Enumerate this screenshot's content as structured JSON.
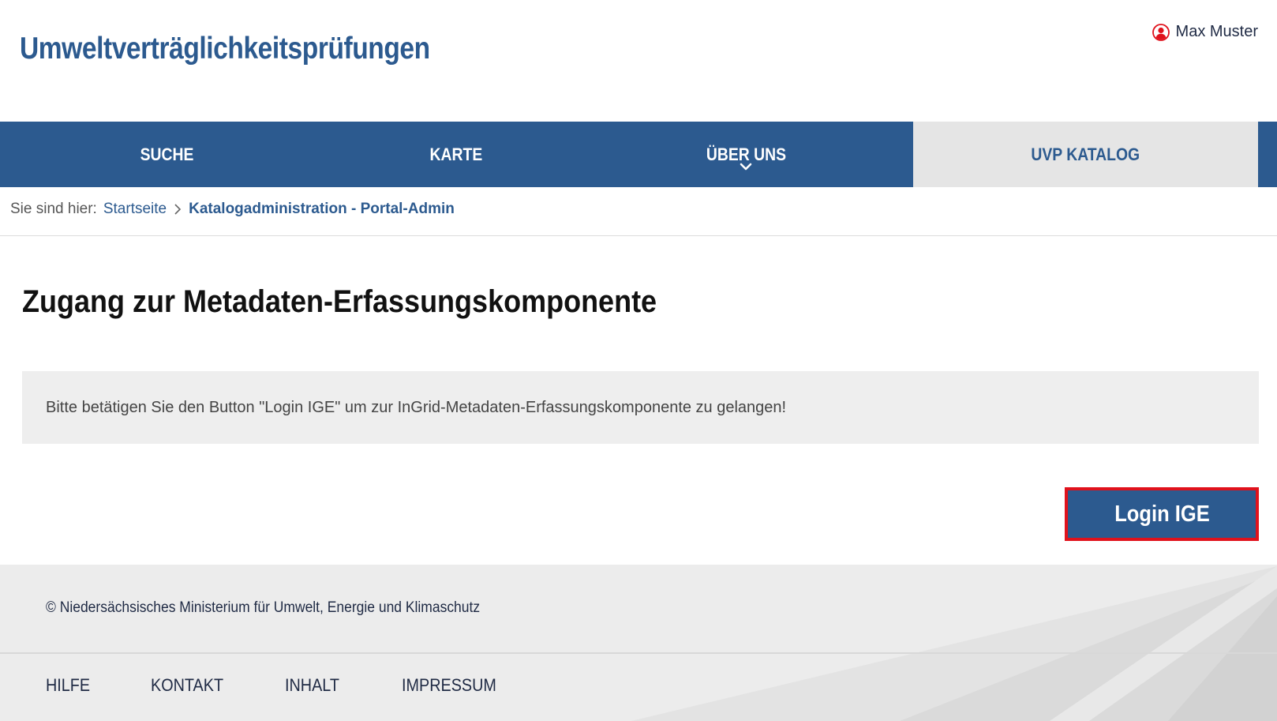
{
  "header": {
    "site_title": "Umweltverträglichkeitsprüfungen",
    "user_name": "Max Muster",
    "user_icon": "user-circle-icon"
  },
  "nav": {
    "items": [
      {
        "label": "SUCHE"
      },
      {
        "label": "KARTE"
      },
      {
        "label": "ÜBER UNS"
      },
      {
        "label": "UVP KATALOG"
      }
    ],
    "active_index": 3
  },
  "breadcrumb": {
    "prefix": "Sie sind hier:",
    "home": "Startseite",
    "current": "Katalogadministration - Portal-Admin"
  },
  "main": {
    "title": "Zugang zur Metadaten-Erfassungskomponente",
    "info_text": "Bitte betätigen Sie den Button \"Login IGE\" um zur InGrid-Metadaten-Erfassungskomponente zu gelangen!",
    "login_button": "Login IGE"
  },
  "footer": {
    "copyright": "© Niedersächsisches Ministerium für Umwelt, Energie und Klimaschutz",
    "links": [
      "HILFE",
      "KONTAKT",
      "INHALT",
      "IMPRESSUM"
    ]
  },
  "colors": {
    "brand_blue": "#2c5a8f",
    "highlight_red": "#e0121c",
    "active_tab_bg": "#e5e5e5",
    "info_bg": "#eeeeee",
    "footer_bg": "#ececec"
  }
}
